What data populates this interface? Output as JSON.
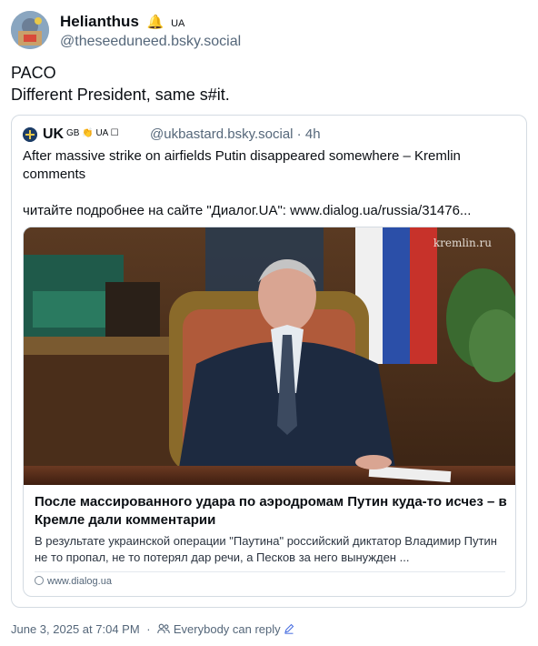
{
  "post": {
    "author": {
      "display_name": "Helianthus",
      "emoji": "🔔",
      "flag_code": "UA",
      "handle": "@theseeduneed.bsky.social"
    },
    "text_lines": [
      "PACO",
      "Different President, same s#it."
    ]
  },
  "quote": {
    "author": {
      "display_name": "UK",
      "meta": "GB 👏 UA ☐",
      "handle": "@ukbastard.bsky.social",
      "time": "4h"
    },
    "text": "After massive strike on airfields Putin disappeared somewhere – Kremlin comments",
    "text_more": "читайте подробнее на сайте \"Диалог.UA\": www.dialog.ua/russia/31476...",
    "link_card": {
      "image_watermark": "kremlin.ru",
      "title": "После массированного удара по аэродромам Путин куда-то исчез – в Кремле дали комментарии",
      "description": "В результате украинской операции \"Паутина\" российский диктатор Владимир Путин не то пропал, не то потерял дар речи, а Песков за него вынужден ...",
      "domain": "www.dialog.ua"
    }
  },
  "footer": {
    "timestamp": "June 3, 2025 at 7:04 PM",
    "separator": "·",
    "reply_setting": "Everybody can reply"
  },
  "colors": {
    "text": "#0b0f14",
    "muted": "#55677a",
    "border": "#d4dbe2"
  },
  "icons": [
    "people-icon",
    "edit-pencil-icon",
    "globe-icon"
  ]
}
